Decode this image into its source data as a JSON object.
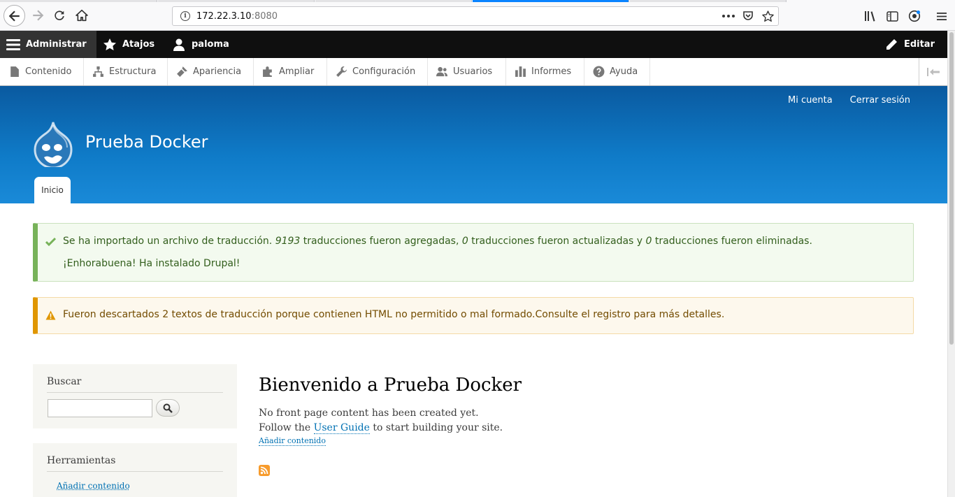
{
  "browser": {
    "url_host": "172.22.3.10",
    "url_port": ":8080"
  },
  "admin_toolbar": {
    "manage_label": "Administrar",
    "shortcuts_label": "Atajos",
    "user_label": "paloma",
    "edit_label": "Editar"
  },
  "admin_tray": {
    "items": [
      {
        "label": "Contenido",
        "icon": "file-icon"
      },
      {
        "label": "Estructura",
        "icon": "sitemap-icon"
      },
      {
        "label": "Apariencia",
        "icon": "paintbrush-icon"
      },
      {
        "label": "Ampliar",
        "icon": "puzzle-icon"
      },
      {
        "label": "Configuración",
        "icon": "wrench-icon"
      },
      {
        "label": "Usuarios",
        "icon": "people-icon"
      },
      {
        "label": "Informes",
        "icon": "bar-chart-icon"
      },
      {
        "label": "Ayuda",
        "icon": "help-icon"
      }
    ]
  },
  "header": {
    "secondary_menu": [
      "Mi cuenta",
      "Cerrar sesión"
    ],
    "site_name": "Prueba Docker",
    "primary_tab": "Inicio"
  },
  "messages": {
    "status": {
      "line1_a": "Se ha importado un archivo de traducción. ",
      "line1_added": "9193",
      "line1_b": " traducciones fueron agregadas, ",
      "line1_updated": "0",
      "line1_c": " traducciones fueron actualizadas y ",
      "line1_deleted": "0",
      "line1_d": " traducciones fueron eliminadas.",
      "line2": "¡Enhorabuena! Ha instalado Drupal!"
    },
    "warning": {
      "text": "Fueron descartados 2 textos de traducción porque contienen HTML no permitido o mal formado.Consulte el registro para más detalles."
    }
  },
  "sidebar": {
    "search_title": "Buscar",
    "search_value": "",
    "tools_title": "Herramientas",
    "tools_link": "Añadir contenido"
  },
  "main": {
    "title": "Bienvenido a Prueba Docker",
    "para1": "No front page content has been created yet.",
    "para2_a": "Follow the ",
    "para2_link": "User Guide",
    "para2_b": " to start building your site.",
    "add_link": "Añadir contenido"
  },
  "colors": {
    "header_blue": "#0f7bc8",
    "status_green": "#77b259",
    "warning_orange": "#e09600",
    "link_blue": "#0071b3"
  }
}
